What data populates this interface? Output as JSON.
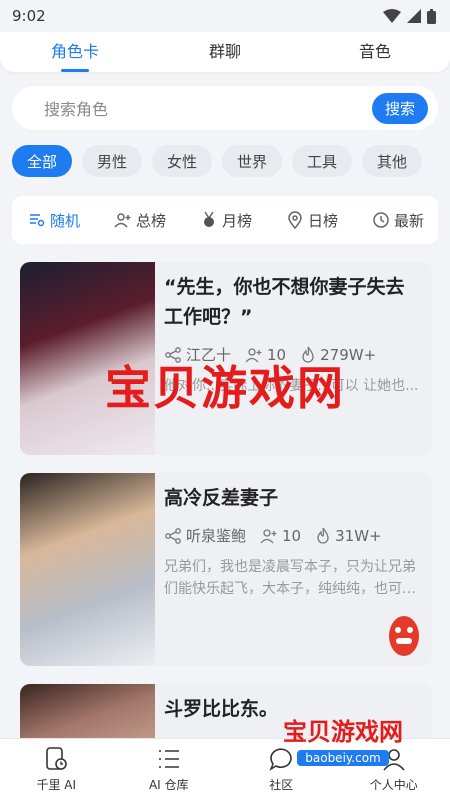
{
  "status_bar": {
    "time": "9:02"
  },
  "top_tabs": [
    {
      "label": "角色卡",
      "active": true
    },
    {
      "label": "群聊",
      "active": false
    },
    {
      "label": "音色",
      "active": false
    }
  ],
  "search": {
    "placeholder": "搜索角色",
    "button": "搜索"
  },
  "filter_chips": [
    {
      "label": "全部",
      "active": true
    },
    {
      "label": "男性"
    },
    {
      "label": "女性"
    },
    {
      "label": "世界"
    },
    {
      "label": "工具"
    },
    {
      "label": "其他"
    }
  ],
  "sort_tabs": [
    {
      "label": "随机",
      "icon": "filter-list-icon",
      "active": true
    },
    {
      "label": "总榜",
      "icon": "user-add-icon"
    },
    {
      "label": "月榜",
      "icon": "medal-icon"
    },
    {
      "label": "日榜",
      "icon": "location-pin-icon"
    },
    {
      "label": "最新",
      "icon": "clock-icon"
    }
  ],
  "cards": [
    {
      "title": "“先生，你也不想你妻子失去工作吧？”",
      "author": "江乙十",
      "users": "10",
      "heat": "279W+",
      "desc": "他对你...实际上你的妻子...可以 让她也..."
    },
    {
      "title": "高冷反差妻子",
      "author": "听泉鉴鲍",
      "users": "10",
      "heat": "31W+",
      "desc": "兄弟们，我也是凌晨写本子，只为让兄弟们能快乐起飞，大本子，纯纯纯，也可…"
    },
    {
      "title": "斗罗比比东。"
    }
  ],
  "watermark": {
    "text": "宝贝游戏网",
    "url": "baobeiy.com"
  },
  "bottom_nav": [
    {
      "label": "千里 AI",
      "icon": "phone-clock-icon"
    },
    {
      "label": "AI 仓库",
      "icon": "list-icon"
    },
    {
      "label": "社区",
      "icon": "chat-bubble-icon"
    },
    {
      "label": "个人中心",
      "icon": "person-icon"
    }
  ],
  "colors": {
    "accent": "#1e7cf0",
    "watermark": "#e41c1c",
    "background": "#f3f4f8"
  }
}
